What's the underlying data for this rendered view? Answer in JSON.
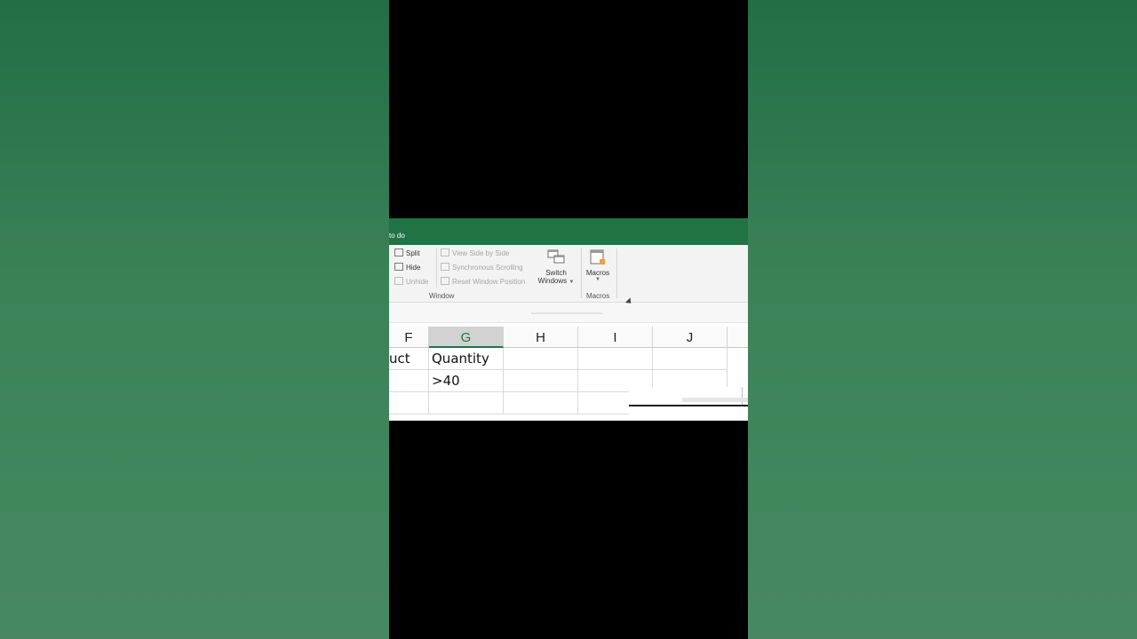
{
  "titlebar": {
    "tell_me": "to do"
  },
  "ribbon": {
    "window_group": {
      "split": "Split",
      "hide": "Hide",
      "unhide": "Unhide",
      "view_side_by_side": "View Side by Side",
      "synchronous_scrolling": "Synchronous Scrolling",
      "reset_window_position": "Reset Window Position",
      "switch_windows_line1": "Switch",
      "switch_windows_line2": "Windows",
      "label": "Window"
    },
    "macros_group": {
      "macros": "Macros",
      "label": "Macros"
    }
  },
  "sheet": {
    "columns": [
      "F",
      "G",
      "H",
      "I",
      "J"
    ],
    "selected_column": "G",
    "rows": [
      [
        "uct",
        "Quantity",
        "",
        "",
        ""
      ],
      [
        "",
        ">40",
        "",
        "",
        ""
      ],
      [
        "",
        "",
        "",
        "",
        ""
      ]
    ]
  },
  "colors": {
    "excel_green": "#217346",
    "background_green": "#3b8259"
  }
}
